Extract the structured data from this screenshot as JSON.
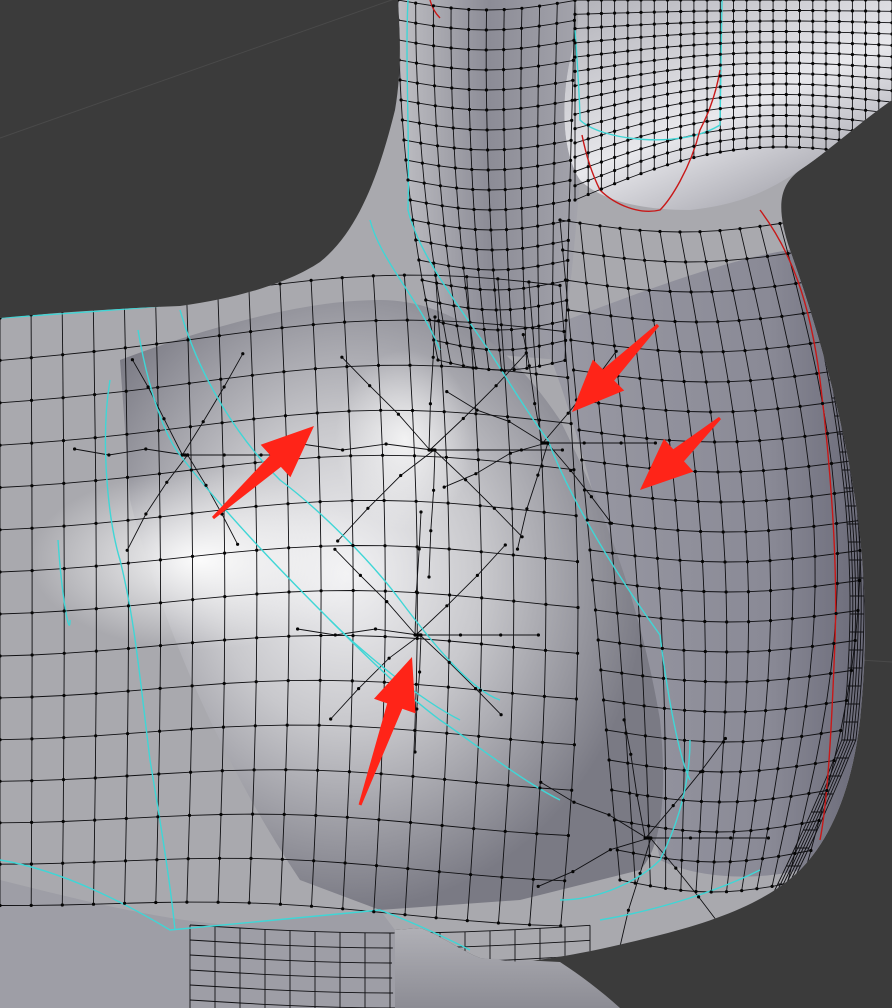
{
  "viewport": {
    "description_label": "",
    "background": "#3b3b3b",
    "mesh_fill_light": "#eeeef0",
    "mesh_fill_mid": "#a9a9ae",
    "mesh_fill_dark": "#6e6e78",
    "wire_color": "#0f0f12",
    "vertex_color": "#050505",
    "seam_color": "#3fd6d6",
    "crease_color": "#c81818",
    "annotation_color": "#ff2418"
  },
  "annotations": [
    {
      "icon": "arrow-icon",
      "color": "#ff2418"
    },
    {
      "icon": "arrow-icon",
      "color": "#ff2418"
    },
    {
      "icon": "arrow-icon",
      "color": "#ff2418"
    },
    {
      "icon": "arrow-icon",
      "color": "#ff2418"
    }
  ]
}
